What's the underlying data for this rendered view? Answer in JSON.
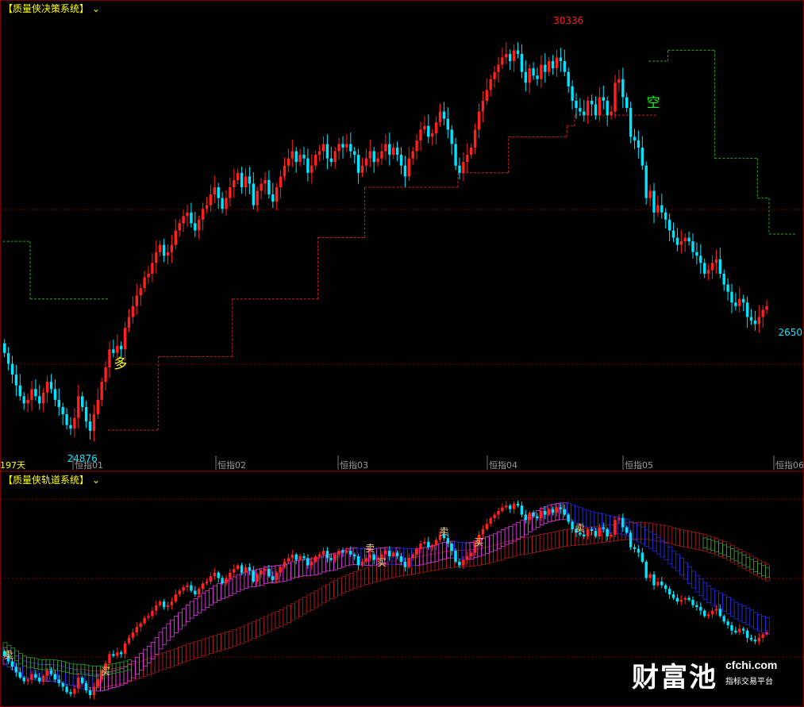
{
  "panels": {
    "top_title": "【质量侠决策系统】",
    "bottom_title": "【质量侠轨道系统】"
  },
  "watermark": {
    "logo_text": "财富池",
    "domain": "cfchi.com",
    "tagline": "指标交易平台"
  },
  "colors": {
    "background": "#000000",
    "up": "#ff2020",
    "down": "#00e5ff",
    "title": "#ffff00",
    "grid": "#8b0000",
    "stop_green": "#22aa22",
    "stop_red": "#cc2222",
    "band_magenta": "#ff3cff",
    "band_blue": "#2233ff",
    "band_green": "#33aa33",
    "band_red": "#cc2222"
  },
  "chart_data": [
    {
      "type": "candlestick",
      "title": "【质量侠决策系统】",
      "x_tick_labels": [
        "197天",
        "恒指01",
        "恒指02",
        "恒指03",
        "恒指04",
        "恒指05",
        "恒指06"
      ],
      "high_label": "30336",
      "low_label": "24876",
      "last_label": "2650",
      "signals": [
        {
          "label": "多",
          "bar": 29,
          "color": "#ffff00"
        },
        {
          "label": "空",
          "bar": 166,
          "color": "#00ff00"
        }
      ],
      "ylim": [
        24600,
        30700
      ],
      "grid": true,
      "open": [
        26135,
        26000,
        25850,
        25700,
        25550,
        25400,
        25300,
        25350,
        25500,
        25400,
        25300,
        25450,
        25600,
        25500,
        25350,
        25250,
        25150,
        25000,
        24950,
        25100,
        25400,
        25250,
        25050,
        24920,
        25150,
        25350,
        25600,
        25800,
        26050,
        26000,
        26100,
        26050,
        26350,
        26500,
        26650,
        26800,
        26900,
        27050,
        27100,
        27250,
        27400,
        27500,
        27350,
        27400,
        27500,
        27700,
        27800,
        27900,
        27950,
        27800,
        27700,
        27850,
        28000,
        28050,
        28200,
        28300,
        28150,
        28000,
        28150,
        28300,
        28400,
        28500,
        28300,
        28450,
        28350,
        28050,
        28250,
        28350,
        28400,
        28200,
        28100,
        28300,
        28450,
        28600,
        28700,
        28800,
        28650,
        28750,
        28700,
        28500,
        28600,
        28750,
        28800,
        28900,
        28700,
        28650,
        28800,
        28900,
        28850,
        28900,
        28800,
        28750,
        28500,
        28600,
        28700,
        28800,
        28650,
        28700,
        28800,
        28900,
        28750,
        28850,
        28750,
        28600,
        28450,
        28700,
        28800,
        28950,
        29100,
        29150,
        29000,
        29050,
        29200,
        29350,
        29250,
        29100,
        28900,
        28600,
        28500,
        28650,
        28750,
        28850,
        29100,
        29350,
        29500,
        29650,
        29800,
        29900,
        30000,
        30100,
        30150,
        30050,
        30200,
        30150,
        29900,
        29750,
        29950,
        29850,
        29800,
        30000,
        29900,
        30050,
        29950,
        30100,
        30050,
        29900,
        29700,
        29500,
        29400,
        29350,
        29300,
        29500,
        29450,
        29300,
        29550,
        29500,
        29300,
        29350,
        29750,
        29800,
        29550,
        29400,
        29000,
        28950,
        28850,
        28600,
        28150,
        28250,
        27950,
        28050,
        27950,
        27850,
        27700,
        27600,
        27500,
        27550,
        27600,
        27550,
        27400,
        27350,
        27250,
        27100,
        27150,
        27250,
        27300,
        27100,
        26950,
        26850,
        26700,
        26650,
        26750,
        26700,
        26500,
        26450,
        26400,
        26500,
        26600
      ],
      "close": [
        26000,
        25850,
        25700,
        25550,
        25400,
        25300,
        25350,
        25500,
        25400,
        25300,
        25450,
        25600,
        25500,
        25350,
        25250,
        25150,
        25000,
        24950,
        25100,
        25400,
        25250,
        25050,
        24920,
        25150,
        25350,
        25600,
        25800,
        26050,
        26000,
        26100,
        26050,
        26350,
        26500,
        26650,
        26800,
        26900,
        27050,
        27100,
        27250,
        27400,
        27500,
        27350,
        27400,
        27500,
        27700,
        27800,
        27900,
        27950,
        27800,
        27700,
        27850,
        28000,
        28050,
        28200,
        28300,
        28150,
        28000,
        28150,
        28300,
        28400,
        28500,
        28300,
        28450,
        28350,
        28050,
        28250,
        28350,
        28400,
        28200,
        28100,
        28300,
        28450,
        28600,
        28700,
        28800,
        28650,
        28750,
        28700,
        28500,
        28600,
        28750,
        28800,
        28900,
        28700,
        28650,
        28800,
        28900,
        28850,
        28900,
        28800,
        28750,
        28500,
        28600,
        28700,
        28800,
        28650,
        28700,
        28800,
        28900,
        28750,
        28850,
        28750,
        28600,
        28450,
        28700,
        28800,
        28950,
        29100,
        29150,
        29000,
        29050,
        29200,
        29350,
        29250,
        29100,
        28900,
        28600,
        28500,
        28650,
        28750,
        28850,
        29100,
        29350,
        29500,
        29650,
        29800,
        29900,
        30000,
        30100,
        30150,
        30050,
        30200,
        30150,
        29900,
        29750,
        29950,
        29850,
        29800,
        30000,
        29900,
        30050,
        29950,
        30100,
        30050,
        29900,
        29700,
        29500,
        29400,
        29350,
        29300,
        29500,
        29450,
        29300,
        29550,
        29500,
        29300,
        29350,
        29750,
        29800,
        29550,
        29400,
        29000,
        28950,
        28850,
        28600,
        28150,
        28250,
        27950,
        28050,
        27950,
        27850,
        27700,
        27600,
        27500,
        27550,
        27600,
        27550,
        27400,
        27350,
        27250,
        27100,
        27150,
        27250,
        27300,
        27100,
        26950,
        26850,
        26700,
        26650,
        26750,
        26700,
        26500,
        26450,
        26400,
        26500,
        26600,
        26650
      ],
      "stop_line": [
        {
          "from": 0,
          "to": 7,
          "value": 27550,
          "color": "green"
        },
        {
          "from": 7,
          "to": 27,
          "value": 26750,
          "color": "green"
        },
        {
          "from": 27,
          "to": 40,
          "value": 24930,
          "color": "red"
        },
        {
          "from": 40,
          "to": 59,
          "value": 25950,
          "color": "red"
        },
        {
          "from": 59,
          "to": 81,
          "value": 26750,
          "color": "red"
        },
        {
          "from": 81,
          "to": 93,
          "value": 27600,
          "color": "red"
        },
        {
          "from": 93,
          "to": 117,
          "value": 28300,
          "color": "red"
        },
        {
          "from": 117,
          "to": 130,
          "value": 28500,
          "color": "red"
        },
        {
          "from": 130,
          "to": 145,
          "value": 29000,
          "color": "red"
        },
        {
          "from": 145,
          "to": 147,
          "value": 29150,
          "color": "red"
        },
        {
          "from": 147,
          "to": 168,
          "value": 29300,
          "color": "red"
        },
        {
          "from": 166,
          "to": 171,
          "value": 30050,
          "color": "green"
        },
        {
          "from": 171,
          "to": 183,
          "value": 30200,
          "color": "green"
        },
        {
          "from": 183,
          "to": 194,
          "value": 28700,
          "color": "green"
        },
        {
          "from": 194,
          "to": 197,
          "value": 28150,
          "color": "green"
        },
        {
          "from": 197,
          "to": 204,
          "value": 27650,
          "color": "green"
        }
      ]
    },
    {
      "type": "candlestick-band",
      "title": "【质量侠轨道系统】",
      "signals": [
        {
          "label": "卖",
          "bar": 1
        },
        {
          "label": "买",
          "bar": 26
        },
        {
          "label": "卖",
          "bar": 94
        },
        {
          "label": "买",
          "bar": 97
        },
        {
          "label": "卖",
          "bar": 113
        },
        {
          "label": "买",
          "bar": 122
        },
        {
          "label": "卖",
          "bar": 148
        }
      ],
      "ylim": [
        24700,
        30700
      ],
      "grid": true
    }
  ]
}
